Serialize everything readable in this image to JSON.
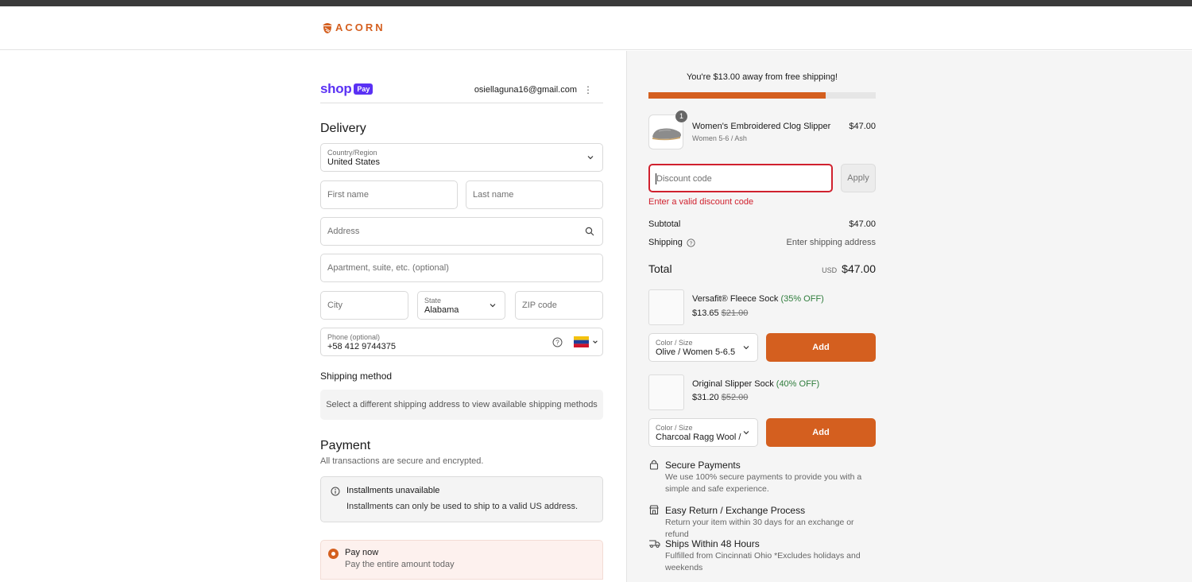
{
  "brand": {
    "name": "ACORN",
    "accent": "#d45f1f"
  },
  "shoppay": {
    "shop": "shop",
    "pay": "Pay",
    "email": "osiellaguna16@gmail.com"
  },
  "delivery": {
    "title": "Delivery",
    "country": {
      "label": "Country/Region",
      "value": "United States"
    },
    "first_name": {
      "placeholder": "First name"
    },
    "last_name": {
      "placeholder": "Last name"
    },
    "address": {
      "placeholder": "Address"
    },
    "apartment": {
      "placeholder": "Apartment, suite, etc. (optional)"
    },
    "city": {
      "placeholder": "City"
    },
    "state": {
      "label": "State",
      "value": "Alabama"
    },
    "zip": {
      "placeholder": "ZIP code"
    },
    "phone": {
      "label": "Phone (optional)",
      "value": "+58 412 9744375"
    }
  },
  "shipping_method": {
    "title": "Shipping method",
    "message": "Select a different shipping address to view available shipping methods"
  },
  "payment": {
    "title": "Payment",
    "subtitle": "All transactions are secure and encrypted.",
    "installments_title": "Installments unavailable",
    "installments_text": "Installments can only be used to ship to a valid US address.",
    "pay_now_title": "Pay now",
    "pay_now_text": "Pay the entire amount today"
  },
  "summary": {
    "free_shipping": "You're $13.00 away from free shipping!",
    "progress": 0.78,
    "item": {
      "quantity": "1",
      "name": "Women's Embroidered Clog Slipper",
      "variant": "Women 5-6 / Ash",
      "price": "$47.00"
    },
    "discount_placeholder": "Discount code",
    "apply": "Apply",
    "discount_error": "Enter a valid discount code",
    "subtotal_label": "Subtotal",
    "subtotal_value": "$47.00",
    "shipping_label": "Shipping",
    "shipping_value": "Enter shipping address",
    "total_label": "Total",
    "total_currency": "USD",
    "total_value": "$47.00"
  },
  "upsells": [
    {
      "name": "Versafit® Fleece Sock",
      "off": "(35% OFF)",
      "price": "$13.65",
      "original": "$21.00",
      "select_label": "Color / Size",
      "select_value": "Olive / Women 5-6.5",
      "add": "Add"
    },
    {
      "name": "Original Slipper Sock",
      "off": "(40% OFF)",
      "price": "$31.20",
      "original": "$52.00",
      "select_label": "Color / Size",
      "select_value": "Charcoal Ragg Wool / ...",
      "add": "Add"
    }
  ],
  "trust": [
    {
      "icon": "lock-icon",
      "title": "Secure Payments",
      "text": "We use 100% secure payments to provide you with a simple and safe experience."
    },
    {
      "icon": "store-icon",
      "title": "Easy Return / Exchange Process",
      "text": "Return your item within 30 days for an exchange or refund"
    },
    {
      "icon": "truck-icon",
      "title": "Ships Within 48 Hours",
      "text": "Fulfilled from Cincinnati Ohio *Excludes holidays and weekends"
    }
  ]
}
